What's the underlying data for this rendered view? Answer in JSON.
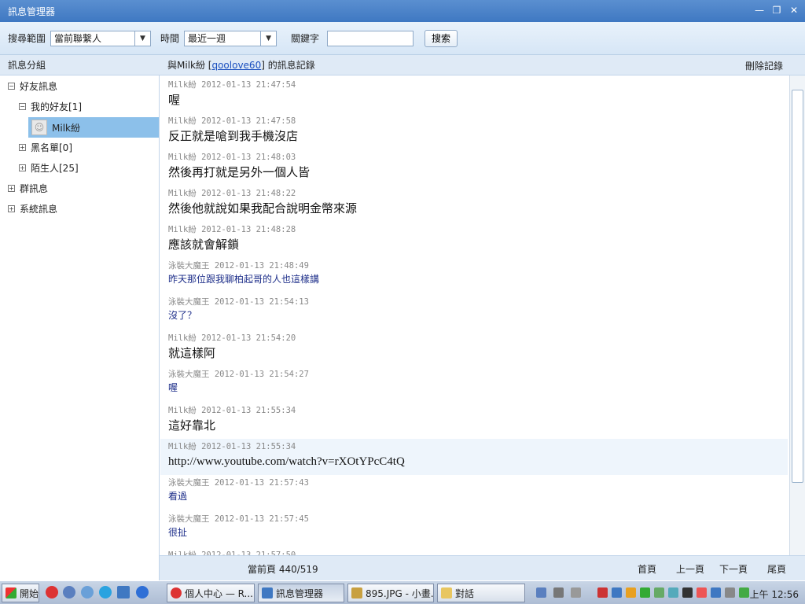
{
  "window": {
    "title": "訊息管理器",
    "min": "—",
    "max": "❐",
    "close": "✕"
  },
  "toolbar": {
    "scope_label": "搜尋範圍",
    "scope_value": "當前聯繫人",
    "time_label": "時間",
    "time_value": "最近一週",
    "keyword_label": "關鍵字",
    "keyword_value": "",
    "search_button": "搜索"
  },
  "left": {
    "header": "訊息分組",
    "tree": {
      "friends": "好友訊息",
      "my_friends": "我的好友[1]",
      "selected_contact": "Milk紛",
      "blacklist": "黑名單[0]",
      "strangers": "陌生人[25]",
      "groups": "群訊息",
      "system": "系統訊息"
    }
  },
  "right": {
    "header_prefix": "與Milk紛 [",
    "header_account": "qoolove60",
    "header_suffix": "] 的訊息記錄",
    "delete": "刪除記錄"
  },
  "messages": [
    {
      "meta": "Milk紛 2012-01-13 21:47:54",
      "text": "喔",
      "self": true
    },
    {
      "meta": "Milk紛 2012-01-13 21:47:58",
      "text": "反正就是嗆到我手機沒店",
      "self": true
    },
    {
      "meta": "Milk紛 2012-01-13 21:48:03",
      "text": "然後再打就是另外一個人皆",
      "self": true
    },
    {
      "meta": "Milk紛 2012-01-13 21:48:22",
      "text": "然後他就說如果我配合說明金幣來源",
      "self": true
    },
    {
      "meta": "Milk紛 2012-01-13 21:48:28",
      "text": "應該就會解鎖",
      "self": true
    },
    {
      "meta": "泳裝大魔王 2012-01-13 21:48:49",
      "text": "昨天那位跟我聊柏起哥的人也這樣講",
      "self": false
    },
    {
      "meta": "泳裝大魔王 2012-01-13 21:54:13",
      "text": "沒了？",
      "self": false
    },
    {
      "meta": "Milk紛 2012-01-13 21:54:20",
      "text": "就這樣阿",
      "self": true
    },
    {
      "meta": "泳裝大魔王 2012-01-13 21:54:27",
      "text": "喔",
      "self": false
    },
    {
      "meta": "Milk紛 2012-01-13 21:55:34",
      "text": "這好靠北",
      "self": true
    },
    {
      "meta": "Milk紛 2012-01-13 21:55:34",
      "text": "http://www.youtube.com/watch?v=rXOtYPcC4tQ",
      "self": true,
      "highlight": true
    },
    {
      "meta": "泳裝大魔王 2012-01-13 21:57:43",
      "text": "看過",
      "self": false
    },
    {
      "meta": "泳裝大魔王 2012-01-13 21:57:45",
      "text": "很扯",
      "self": false
    },
    {
      "meta": "Milk紛 2012-01-13 21:57:50",
      "text": "",
      "self": true
    }
  ],
  "pager": {
    "current": "當前頁 440/519",
    "first": "首頁",
    "prev": "上一頁",
    "next": "下一頁",
    "last": "尾頁"
  },
  "taskbar": {
    "start": "開始",
    "tasks": [
      "個人中心 — R...",
      "訊息管理器",
      "895.JPG - 小畫...",
      "對話"
    ],
    "clock": "上午 12:56"
  }
}
